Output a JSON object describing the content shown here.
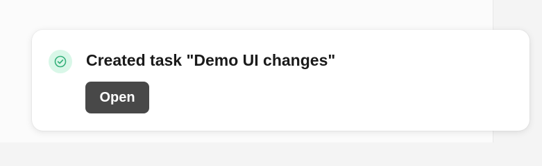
{
  "toast": {
    "message": "Created task \"Demo UI changes\"",
    "status_icon": "check-circle-icon",
    "status_color": "#35b07a",
    "status_bg": "#d9f7e8",
    "open_label": "Open"
  }
}
